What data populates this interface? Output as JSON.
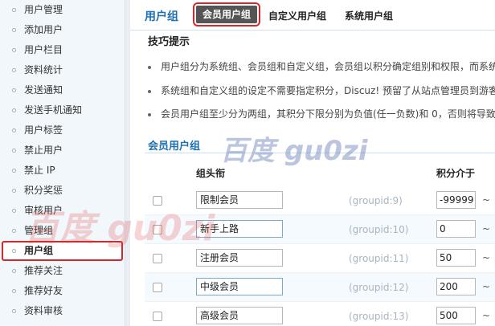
{
  "sidebar": {
    "items": [
      {
        "label": "用户管理",
        "active": false
      },
      {
        "label": "添加用户",
        "active": false
      },
      {
        "label": "用户栏目",
        "active": false
      },
      {
        "label": "资料统计",
        "active": false
      },
      {
        "label": "发送通知",
        "active": false
      },
      {
        "label": "发送手机通知",
        "active": false
      },
      {
        "label": "用户标签",
        "active": false
      },
      {
        "label": "禁止用户",
        "active": false
      },
      {
        "label": "禁止 IP",
        "active": false
      },
      {
        "label": "积分奖惩",
        "active": false
      },
      {
        "label": "审核用户",
        "active": false
      },
      {
        "label": "管理组",
        "active": false
      },
      {
        "label": "用户组",
        "active": true
      },
      {
        "label": "推荐关注",
        "active": false
      },
      {
        "label": "推荐好友",
        "active": false
      },
      {
        "label": "资料审核",
        "active": false
      }
    ]
  },
  "header": {
    "title": "用户组",
    "tabs": [
      {
        "label": "会员用户组",
        "active": true
      },
      {
        "label": "自定义用户组",
        "active": false
      },
      {
        "label": "系统用户组",
        "active": false
      }
    ]
  },
  "tips": {
    "title": "技巧提示",
    "items": [
      "用户组分为系统组、会员组和自定义组，会员组以积分确定组别和权限，而系统",
      "系统组和自定义组的设定不需要指定积分，Discuz! 预留了从站点管理员到游客",
      "会员用户组至少分为两组，其积分下限分别为负值(任一负数)和 0，否则将导致"
    ]
  },
  "section": {
    "title": "会员用户组",
    "columns": {
      "name": "组头衔",
      "credits": "积分介于"
    }
  },
  "groups": [
    {
      "name": "限制会员",
      "gid": "(groupid:9)",
      "min": "-99999"
    },
    {
      "name": "新手上路",
      "gid": "(groupid:10)",
      "min": "0"
    },
    {
      "name": "注册会员",
      "gid": "(groupid:11)",
      "min": "50"
    },
    {
      "name": "中级会员",
      "gid": "(groupid:12)",
      "min": "200"
    },
    {
      "name": "高级会员",
      "gid": "(groupid:13)",
      "min": "500"
    }
  ],
  "tilde": "~",
  "watermarks": {
    "top": "百度 gu0zi",
    "left": "百度 gu0zi"
  },
  "colors": {
    "accent_blue": "#1c6fb0",
    "highlight_red": "#d9262b",
    "active_tab_bg": "#555555"
  }
}
